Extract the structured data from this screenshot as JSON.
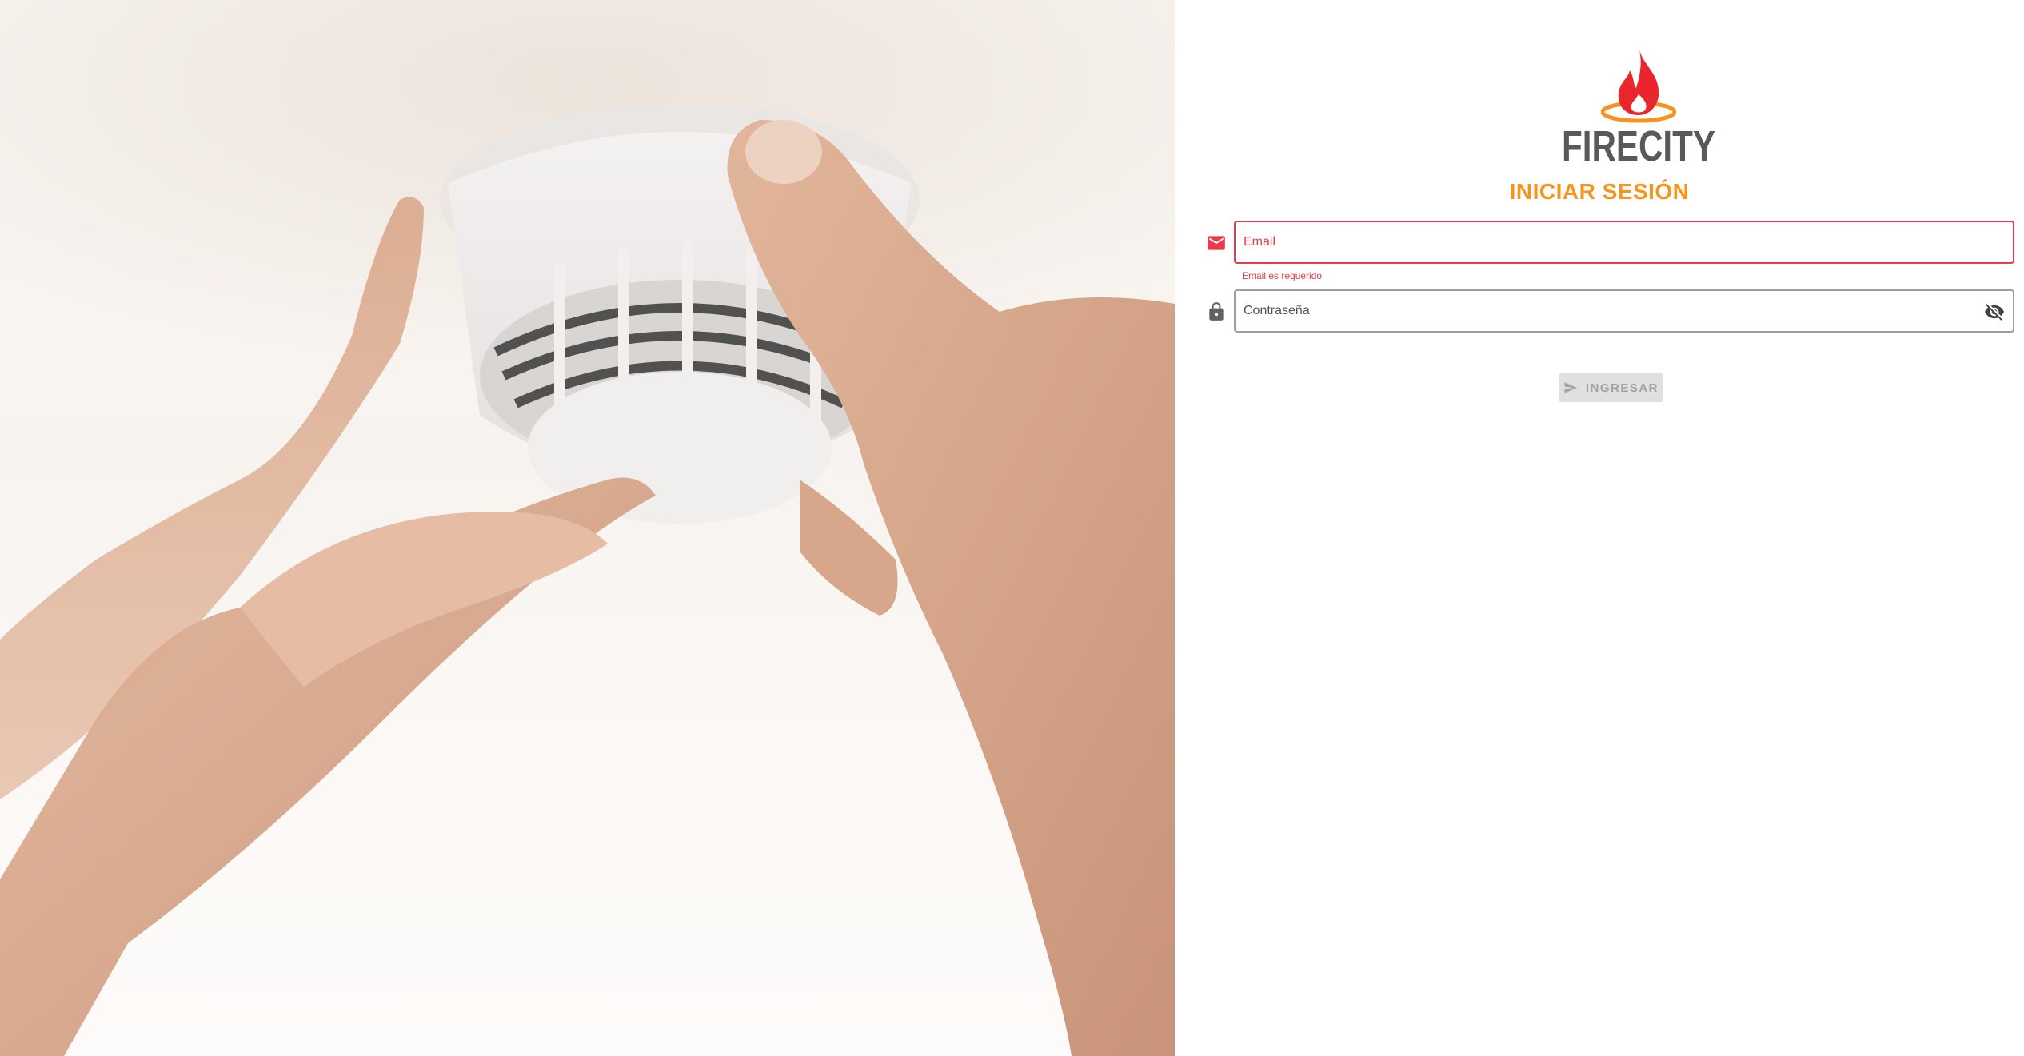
{
  "brand": {
    "name": "FIRECITY",
    "accent_color": "#f7941d",
    "flame_color": "#e8262b",
    "ring_color": "#f7941d",
    "logo_icon": "flame-logo-icon"
  },
  "hero": {
    "image": "hands-installing-smoke-detector-photo"
  },
  "login": {
    "title": "INICIAR SESIÓN",
    "email": {
      "placeholder": "Email",
      "value": "",
      "icon": "mail-icon",
      "error": "Email es requerido",
      "error_color": "#e53b4c"
    },
    "password": {
      "placeholder": "Contraseña",
      "value": "",
      "icon": "lock-icon",
      "toggle_icon": "eye-off-icon"
    },
    "submit": {
      "label": "INGRESAR",
      "icon": "send-icon",
      "disabled": true
    }
  }
}
